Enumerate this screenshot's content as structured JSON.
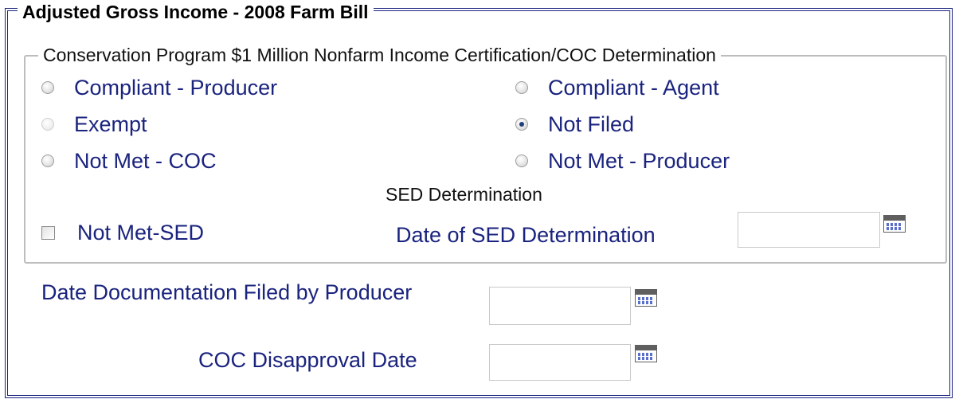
{
  "section": {
    "title": "Adjusted Gross Income - 2008 Farm Bill"
  },
  "group": {
    "title": "Conservation Program $1 Million Nonfarm Income Certification/COC Determination",
    "radios": [
      {
        "label": "Compliant - Producer",
        "checked": false,
        "disabled": false
      },
      {
        "label": "Compliant - Agent",
        "checked": false,
        "disabled": false
      },
      {
        "label": "Exempt",
        "checked": false,
        "disabled": true
      },
      {
        "label": "Not Filed",
        "checked": true,
        "disabled": false
      },
      {
        "label": "Not Met - COC",
        "checked": false,
        "disabled": false
      },
      {
        "label": "Not Met - Producer",
        "checked": false,
        "disabled": false
      }
    ],
    "sed_heading": "SED Determination",
    "not_met_sed": {
      "label": "Not Met-SED",
      "checked": false
    },
    "sed_date": {
      "label": "Date of SED Determination",
      "value": ""
    }
  },
  "fields": {
    "doc_filed": {
      "label": "Date Documentation Filed by Producer",
      "value": ""
    },
    "coc_disapproval": {
      "label": "COC Disapproval Date",
      "value": ""
    }
  },
  "icons": {
    "calendar": "calendar-icon"
  },
  "colors": {
    "label_text": "#1a237e",
    "border": "#1a237e",
    "radio_dot": "#1f3f7a"
  }
}
